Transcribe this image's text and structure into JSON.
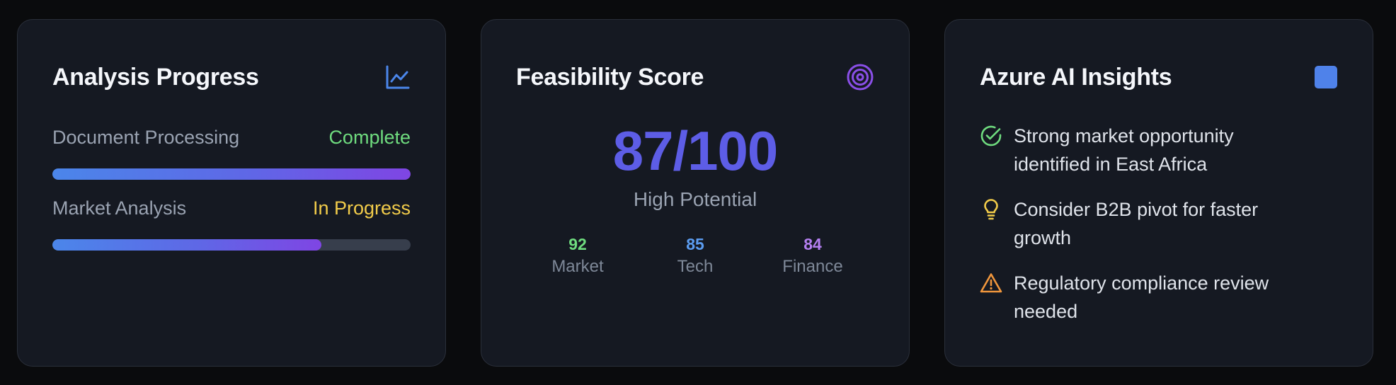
{
  "cards": {
    "progress": {
      "title": "Analysis Progress",
      "icon": "line-chart-icon",
      "items": [
        {
          "label": "Document Processing",
          "status": "Complete",
          "status_color": "#6fdc7f",
          "progress": 1.0
        },
        {
          "label": "Market Analysis",
          "status": "In Progress",
          "status_color": "#f2cc4a",
          "progress": 0.75
        }
      ]
    },
    "feasibility": {
      "title": "Feasibility Score",
      "icon": "target-icon",
      "score": "87/100",
      "rating": "High Potential",
      "metrics": [
        {
          "value": "92",
          "label": "Market",
          "color": "#6fdc7f"
        },
        {
          "value": "85",
          "label": "Tech",
          "color": "#5b9cf0"
        },
        {
          "value": "84",
          "label": "Finance",
          "color": "#b47ff0"
        }
      ]
    },
    "insights": {
      "title": "Azure AI Insights",
      "icon": "azure-square-icon",
      "items": [
        {
          "text": "Strong market opportunity identified in East Africa",
          "icon": "check-circle-icon",
          "color": "#6fdc7f"
        },
        {
          "text": "Consider B2B pivot for faster growth",
          "icon": "lightbulb-icon",
          "color": "#f2cc4a"
        },
        {
          "text": "Regulatory compliance review needed",
          "icon": "warning-triangle-icon",
          "color": "#f0963c"
        }
      ]
    }
  },
  "colors": {
    "accent_blue": "#4b86ea",
    "accent_purple": "#7f45e4",
    "score": "#5d5de6"
  }
}
